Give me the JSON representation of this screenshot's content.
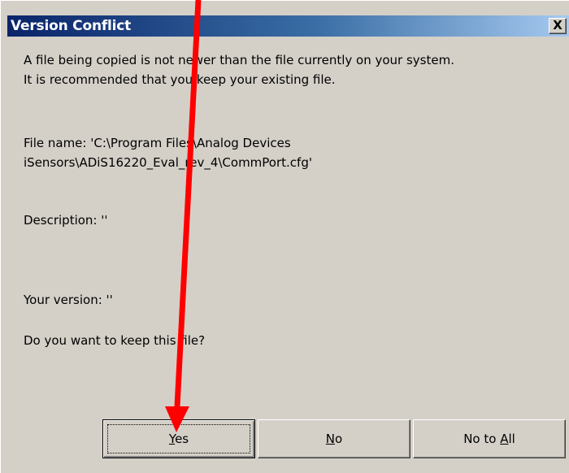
{
  "dialog": {
    "title": "Version Conflict",
    "close_glyph": "X"
  },
  "message": {
    "line1": "A file being copied is not newer than the file currently on your system.",
    "line2": "It is recommended that you keep your existing file.",
    "file_name_line1": "File name:   'C:\\Program Files\\Analog Devices",
    "file_name_line2": "iSensors\\ADiS16220_Eval_rev_4\\CommPort.cfg'",
    "description": "Description:  ''",
    "your_version": "Your version:  ''",
    "question": "Do you want to keep this file?"
  },
  "buttons": {
    "yes": {
      "mnemonic": "Y",
      "rest": "es"
    },
    "no": {
      "mnemonic": "N",
      "rest": "o"
    },
    "no_to_all": {
      "prefix": "No to ",
      "mnemonic": "A",
      "rest": "ll"
    }
  },
  "annotation": {
    "arrow_color": "#ff0000",
    "points_to": "yes-button"
  },
  "colors": {
    "title_bar_start": "#0a246a",
    "title_bar_end": "#a6caf0",
    "dialog_face": "#d4d0c8"
  }
}
